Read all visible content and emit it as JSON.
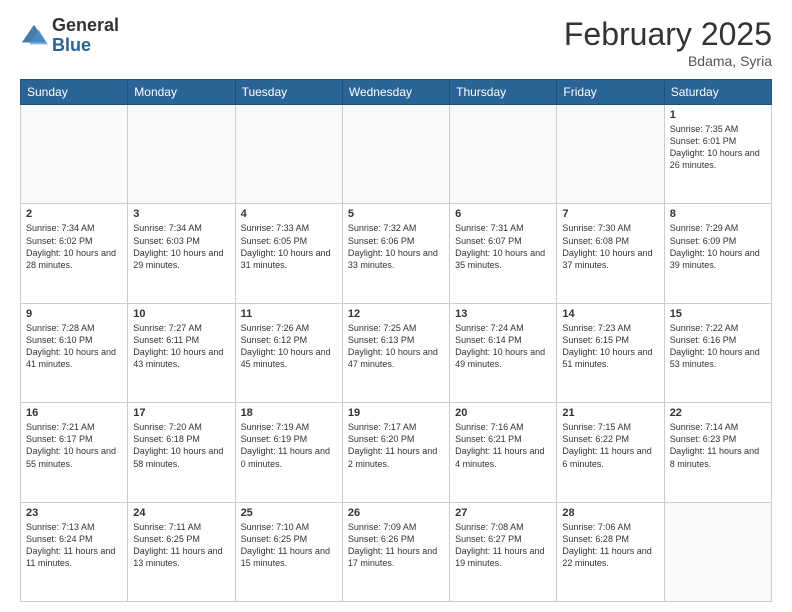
{
  "header": {
    "logo": {
      "general": "General",
      "blue": "Blue"
    },
    "title": "February 2025",
    "location": "Bdama, Syria"
  },
  "calendar": {
    "days_of_week": [
      "Sunday",
      "Monday",
      "Tuesday",
      "Wednesday",
      "Thursday",
      "Friday",
      "Saturday"
    ],
    "weeks": [
      [
        {
          "day": "",
          "content": ""
        },
        {
          "day": "",
          "content": ""
        },
        {
          "day": "",
          "content": ""
        },
        {
          "day": "",
          "content": ""
        },
        {
          "day": "",
          "content": ""
        },
        {
          "day": "",
          "content": ""
        },
        {
          "day": "1",
          "content": "Sunrise: 7:35 AM\nSunset: 6:01 PM\nDaylight: 10 hours and 26 minutes."
        }
      ],
      [
        {
          "day": "2",
          "content": "Sunrise: 7:34 AM\nSunset: 6:02 PM\nDaylight: 10 hours and 28 minutes."
        },
        {
          "day": "3",
          "content": "Sunrise: 7:34 AM\nSunset: 6:03 PM\nDaylight: 10 hours and 29 minutes."
        },
        {
          "day": "4",
          "content": "Sunrise: 7:33 AM\nSunset: 6:05 PM\nDaylight: 10 hours and 31 minutes."
        },
        {
          "day": "5",
          "content": "Sunrise: 7:32 AM\nSunset: 6:06 PM\nDaylight: 10 hours and 33 minutes."
        },
        {
          "day": "6",
          "content": "Sunrise: 7:31 AM\nSunset: 6:07 PM\nDaylight: 10 hours and 35 minutes."
        },
        {
          "day": "7",
          "content": "Sunrise: 7:30 AM\nSunset: 6:08 PM\nDaylight: 10 hours and 37 minutes."
        },
        {
          "day": "8",
          "content": "Sunrise: 7:29 AM\nSunset: 6:09 PM\nDaylight: 10 hours and 39 minutes."
        }
      ],
      [
        {
          "day": "9",
          "content": "Sunrise: 7:28 AM\nSunset: 6:10 PM\nDaylight: 10 hours and 41 minutes."
        },
        {
          "day": "10",
          "content": "Sunrise: 7:27 AM\nSunset: 6:11 PM\nDaylight: 10 hours and 43 minutes."
        },
        {
          "day": "11",
          "content": "Sunrise: 7:26 AM\nSunset: 6:12 PM\nDaylight: 10 hours and 45 minutes."
        },
        {
          "day": "12",
          "content": "Sunrise: 7:25 AM\nSunset: 6:13 PM\nDaylight: 10 hours and 47 minutes."
        },
        {
          "day": "13",
          "content": "Sunrise: 7:24 AM\nSunset: 6:14 PM\nDaylight: 10 hours and 49 minutes."
        },
        {
          "day": "14",
          "content": "Sunrise: 7:23 AM\nSunset: 6:15 PM\nDaylight: 10 hours and 51 minutes."
        },
        {
          "day": "15",
          "content": "Sunrise: 7:22 AM\nSunset: 6:16 PM\nDaylight: 10 hours and 53 minutes."
        }
      ],
      [
        {
          "day": "16",
          "content": "Sunrise: 7:21 AM\nSunset: 6:17 PM\nDaylight: 10 hours and 55 minutes."
        },
        {
          "day": "17",
          "content": "Sunrise: 7:20 AM\nSunset: 6:18 PM\nDaylight: 10 hours and 58 minutes."
        },
        {
          "day": "18",
          "content": "Sunrise: 7:19 AM\nSunset: 6:19 PM\nDaylight: 11 hours and 0 minutes."
        },
        {
          "day": "19",
          "content": "Sunrise: 7:17 AM\nSunset: 6:20 PM\nDaylight: 11 hours and 2 minutes."
        },
        {
          "day": "20",
          "content": "Sunrise: 7:16 AM\nSunset: 6:21 PM\nDaylight: 11 hours and 4 minutes."
        },
        {
          "day": "21",
          "content": "Sunrise: 7:15 AM\nSunset: 6:22 PM\nDaylight: 11 hours and 6 minutes."
        },
        {
          "day": "22",
          "content": "Sunrise: 7:14 AM\nSunset: 6:23 PM\nDaylight: 11 hours and 8 minutes."
        }
      ],
      [
        {
          "day": "23",
          "content": "Sunrise: 7:13 AM\nSunset: 6:24 PM\nDaylight: 11 hours and 11 minutes."
        },
        {
          "day": "24",
          "content": "Sunrise: 7:11 AM\nSunset: 6:25 PM\nDaylight: 11 hours and 13 minutes."
        },
        {
          "day": "25",
          "content": "Sunrise: 7:10 AM\nSunset: 6:25 PM\nDaylight: 11 hours and 15 minutes."
        },
        {
          "day": "26",
          "content": "Sunrise: 7:09 AM\nSunset: 6:26 PM\nDaylight: 11 hours and 17 minutes."
        },
        {
          "day": "27",
          "content": "Sunrise: 7:08 AM\nSunset: 6:27 PM\nDaylight: 11 hours and 19 minutes."
        },
        {
          "day": "28",
          "content": "Sunrise: 7:06 AM\nSunset: 6:28 PM\nDaylight: 11 hours and 22 minutes."
        },
        {
          "day": "",
          "content": ""
        }
      ]
    ]
  }
}
